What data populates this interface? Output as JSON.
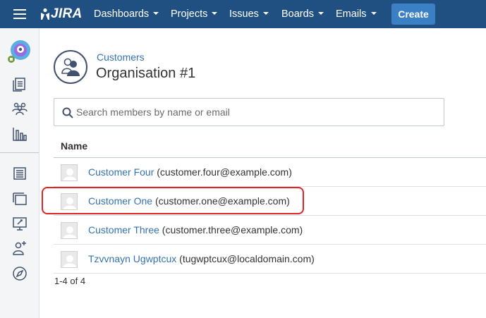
{
  "nav": {
    "logo_text": "JIRA",
    "items": [
      {
        "label": "Dashboards"
      },
      {
        "label": "Projects"
      },
      {
        "label": "Issues"
      },
      {
        "label": "Boards"
      },
      {
        "label": "Emails"
      }
    ],
    "create_label": "Create",
    "brand_color": "#205081",
    "create_color": "#3b7fc4"
  },
  "sidebar": {
    "icons": [
      "project-avatar-icon",
      "queues-icon",
      "customers-icon",
      "reports-icon",
      "knowledge-base-icon",
      "channels-icon",
      "raise-request-icon",
      "invite-team-icon",
      "discover-icon"
    ]
  },
  "header": {
    "breadcrumb": "Customers",
    "title": "Organisation #1"
  },
  "search": {
    "placeholder": "Search members by name or email",
    "value": ""
  },
  "table": {
    "column_name": "Name",
    "rows": [
      {
        "name": "Customer Four",
        "email": "(customer.four@example.com)"
      },
      {
        "name": "Customer One",
        "email": "(customer.one@example.com)"
      },
      {
        "name": "Customer Three",
        "email": "(customer.three@example.com)"
      },
      {
        "name": "Tzvvnayn Ugwptcux",
        "email": "(tugwptcux@localdomain.com)"
      }
    ]
  },
  "pagination": "1-4 of 4"
}
